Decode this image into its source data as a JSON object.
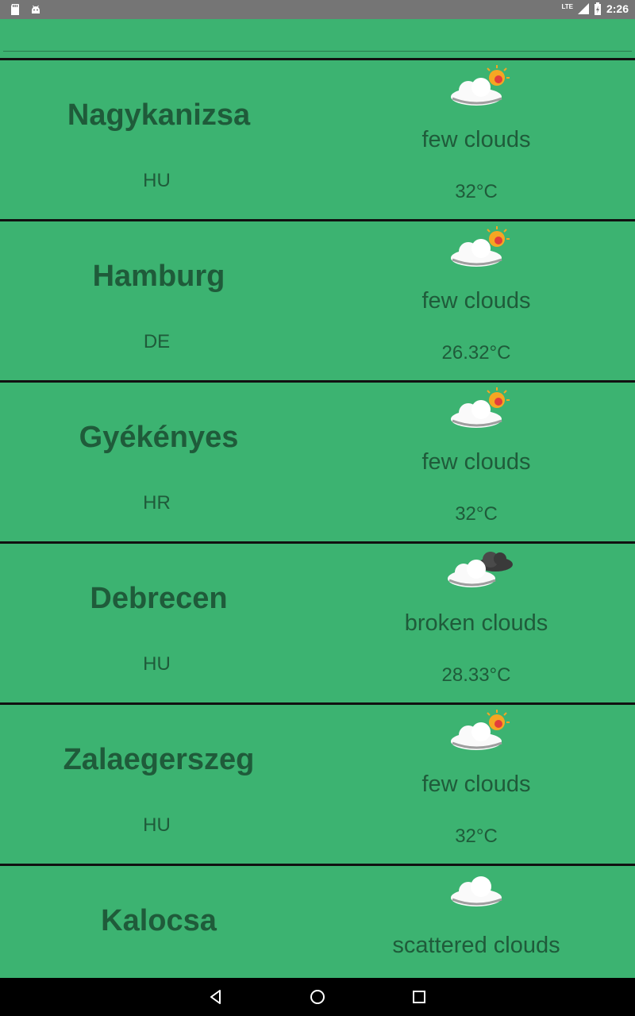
{
  "status_bar": {
    "time": "2:26",
    "network": "LTE",
    "icons": [
      "sd-card-icon",
      "android-icon",
      "signal-icon",
      "battery-charging-icon"
    ]
  },
  "search": {
    "value": "",
    "placeholder": ""
  },
  "cities": [
    {
      "city": "Nagykanizsa",
      "country": "HU",
      "description": "few clouds",
      "temperature": "32°C",
      "icon": "few-clouds-icon"
    },
    {
      "city": "Hamburg",
      "country": "DE",
      "description": "few clouds",
      "temperature": "26.32°C",
      "icon": "few-clouds-icon"
    },
    {
      "city": "Gyékényes",
      "country": "HR",
      "description": "few clouds",
      "temperature": "32°C",
      "icon": "few-clouds-icon"
    },
    {
      "city": "Debrecen",
      "country": "HU",
      "description": "broken clouds",
      "temperature": "28.33°C",
      "icon": "broken-clouds-icon"
    },
    {
      "city": "Zalaegerszeg",
      "country": "HU",
      "description": "few clouds",
      "temperature": "32°C",
      "icon": "few-clouds-icon"
    },
    {
      "city": "Kalocsa",
      "country": "",
      "description": "scattered clouds",
      "temperature": "",
      "icon": "scattered-clouds-icon"
    }
  ],
  "navigation": {
    "buttons": [
      "back-icon",
      "home-icon",
      "recents-icon"
    ]
  },
  "colors": {
    "background": "#3cb371",
    "text": "#1f5b3a",
    "divider": "#111111",
    "status_bar": "#757575",
    "nav_bar": "#000000"
  }
}
